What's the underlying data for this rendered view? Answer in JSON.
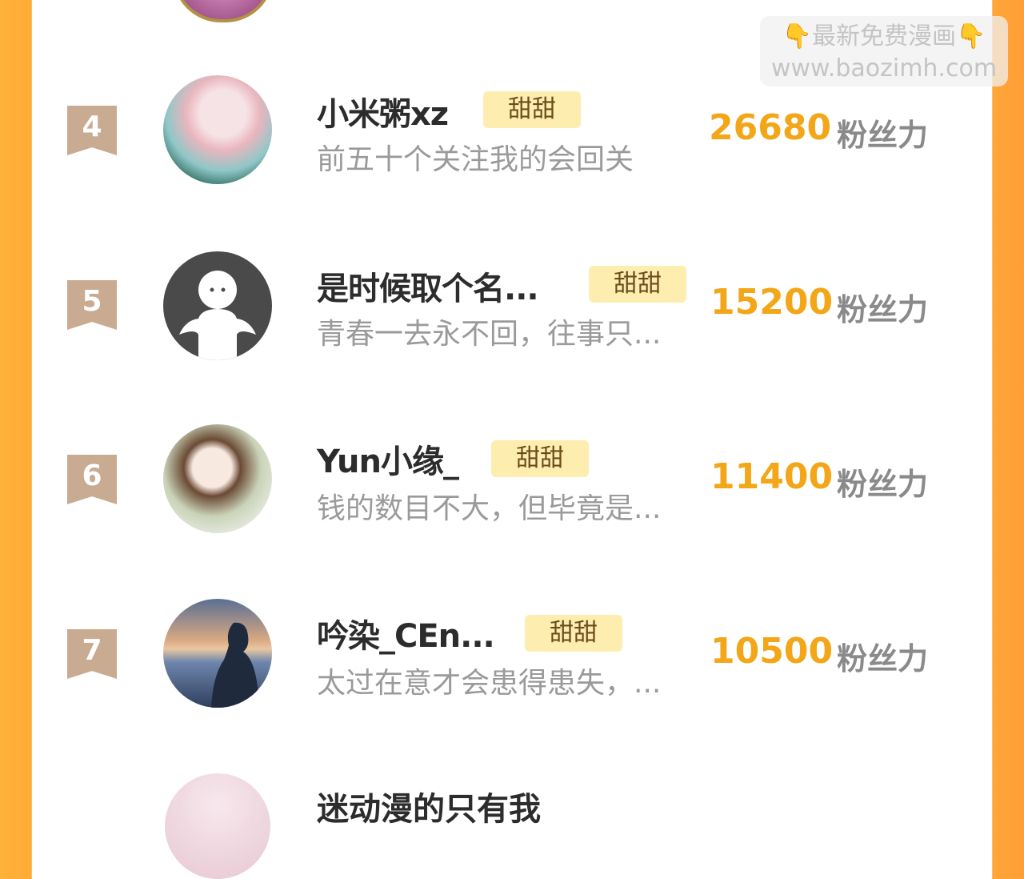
{
  "watermark": {
    "line1": "👇最新免费漫画👇",
    "line2": "www.baozimh.com"
  },
  "entries": [
    {
      "rank": "4",
      "name": "小米粥xz",
      "badge": "甜甜",
      "signature": "前五十个关注我的会回关",
      "score": "26680",
      "unit": "粉丝力"
    },
    {
      "rank": "5",
      "name": "是时候取个名...",
      "badge": "甜甜",
      "signature": "青春一去永不回，往事只...",
      "score": "15200",
      "unit": "粉丝力"
    },
    {
      "rank": "6",
      "name": "Yun小缘_",
      "badge": "甜甜",
      "signature": "钱的数目不大，但毕竟是...",
      "score": "11400",
      "unit": "粉丝力"
    },
    {
      "rank": "7",
      "name": "吟染_CEn...",
      "badge": "甜甜",
      "signature": "太过在意才会患得患失，...",
      "score": "10500",
      "unit": "粉丝力"
    }
  ],
  "partial_entry": {
    "name": "迷动漫的只有我"
  }
}
